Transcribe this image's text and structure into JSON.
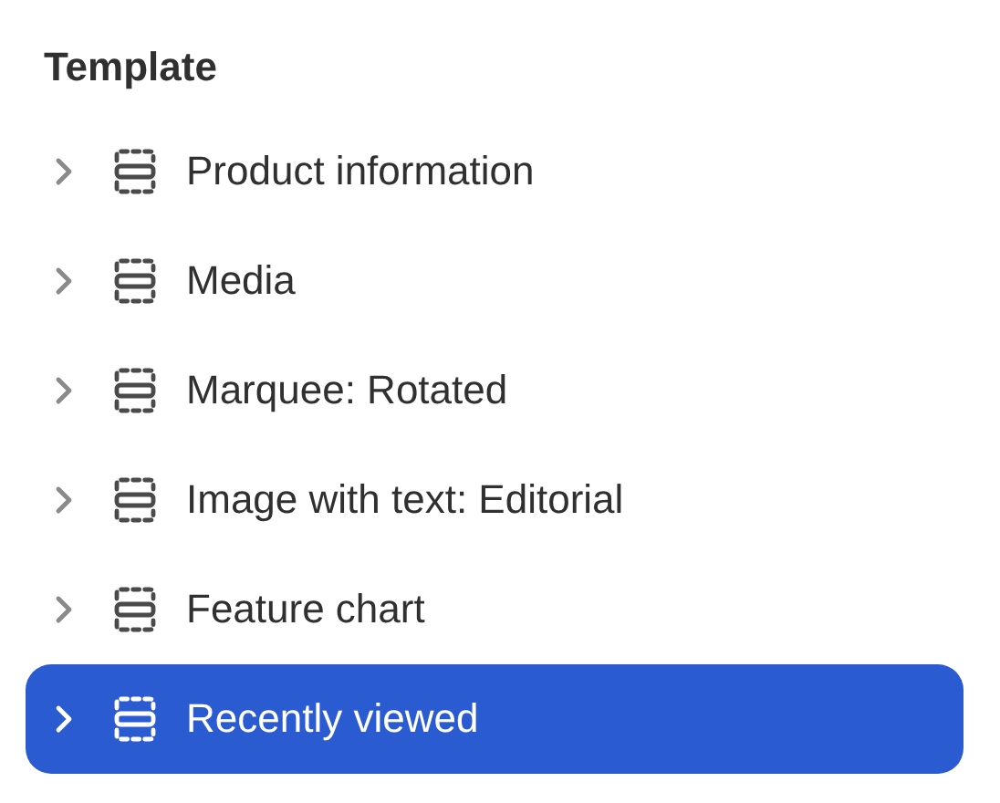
{
  "heading": "Template",
  "items": [
    {
      "label": "Product information",
      "selected": false,
      "expanded": false
    },
    {
      "label": "Media",
      "selected": false,
      "expanded": false
    },
    {
      "label": "Marquee: Rotated",
      "selected": false,
      "expanded": false
    },
    {
      "label": "Image with text: Editorial",
      "selected": false,
      "expanded": false
    },
    {
      "label": "Feature chart",
      "selected": false,
      "expanded": false
    },
    {
      "label": "Recently viewed",
      "selected": true,
      "expanded": false
    }
  ]
}
